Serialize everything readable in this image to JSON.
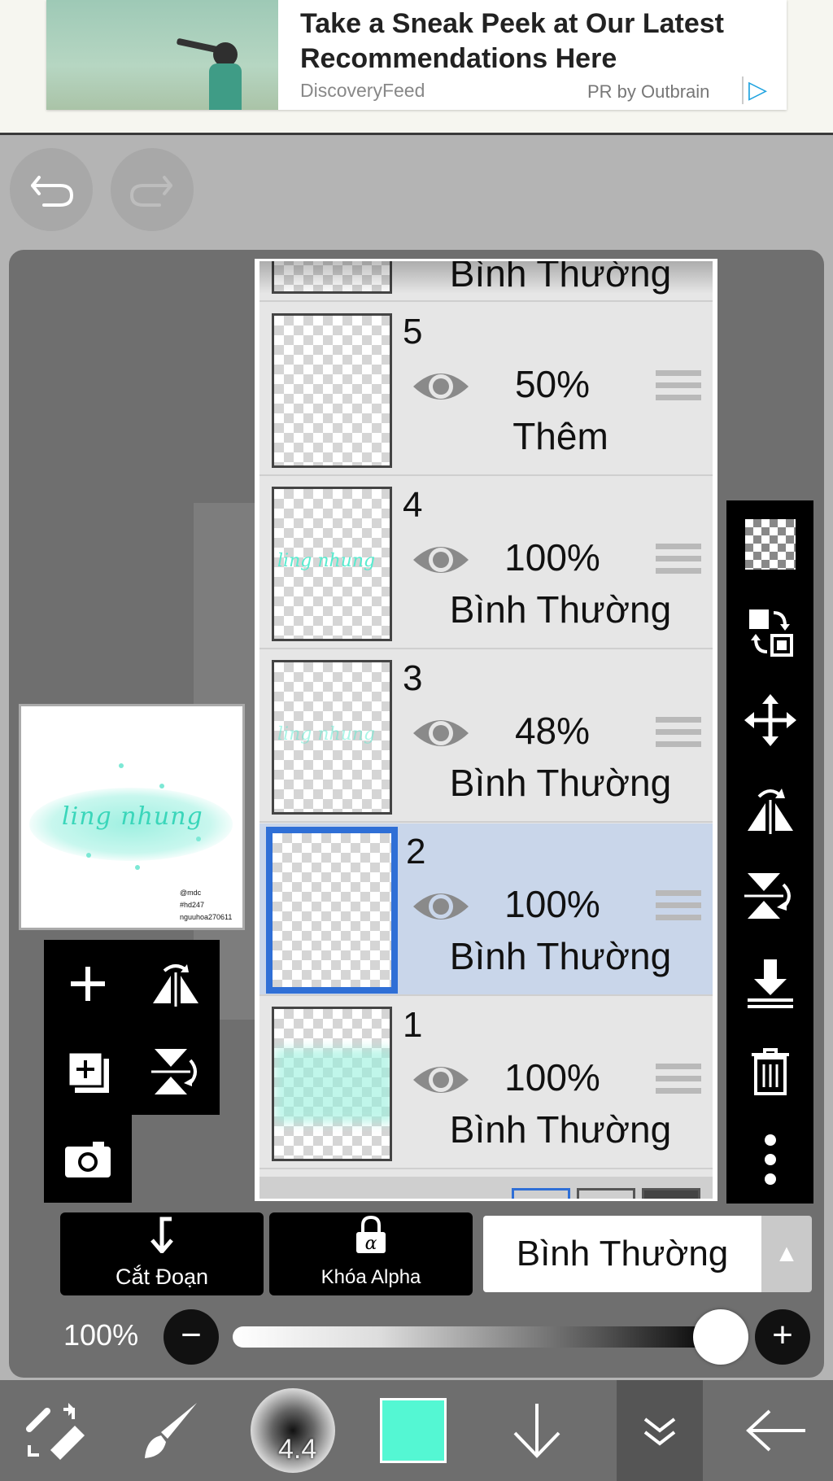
{
  "ad": {
    "headline": "Take a Sneak Peek at Our Latest Recommendations Here",
    "source": "DiscoveryFeed",
    "sponsor": "PR by Outbrain"
  },
  "icons": {
    "undo": "undo-icon",
    "redo": "redo-icon",
    "add_layer": "plus-icon",
    "flip_horizontal": "flip-horizontal-icon",
    "add_copy": "add-copy-icon",
    "flip_vertical": "flip-vertical-icon",
    "camera": "camera-icon"
  },
  "layers": {
    "top_partial_mode": "Bình Thường",
    "items": [
      {
        "num": "5",
        "opacity": "50%",
        "mode": "Thêm",
        "selected": false
      },
      {
        "num": "4",
        "opacity": "100%",
        "mode": "Bình Thường",
        "selected": false,
        "thumb_text": "ling nhung"
      },
      {
        "num": "3",
        "opacity": "48%",
        "mode": "Bình Thường",
        "selected": false,
        "thumb_text": "ling nhung"
      },
      {
        "num": "2",
        "opacity": "100%",
        "mode": "Bình Thường",
        "selected": true
      },
      {
        "num": "1",
        "opacity": "100%",
        "mode": "Bình Thường",
        "selected": false
      }
    ]
  },
  "preview": {
    "art_text": "ling nhung",
    "credit_lines": [
      "@mdc",
      "#hd247",
      "nguuhoa270611"
    ]
  },
  "layer_controls": {
    "clipping_label": "Cắt Đoạn",
    "alpha_lock_label": "Khóa Alpha",
    "blend_mode": "Bình Thường",
    "opacity_label": "100%",
    "opacity_value": 1.0
  },
  "bottom_bar": {
    "brush_size": "4.4",
    "color": "#54f7d3"
  }
}
